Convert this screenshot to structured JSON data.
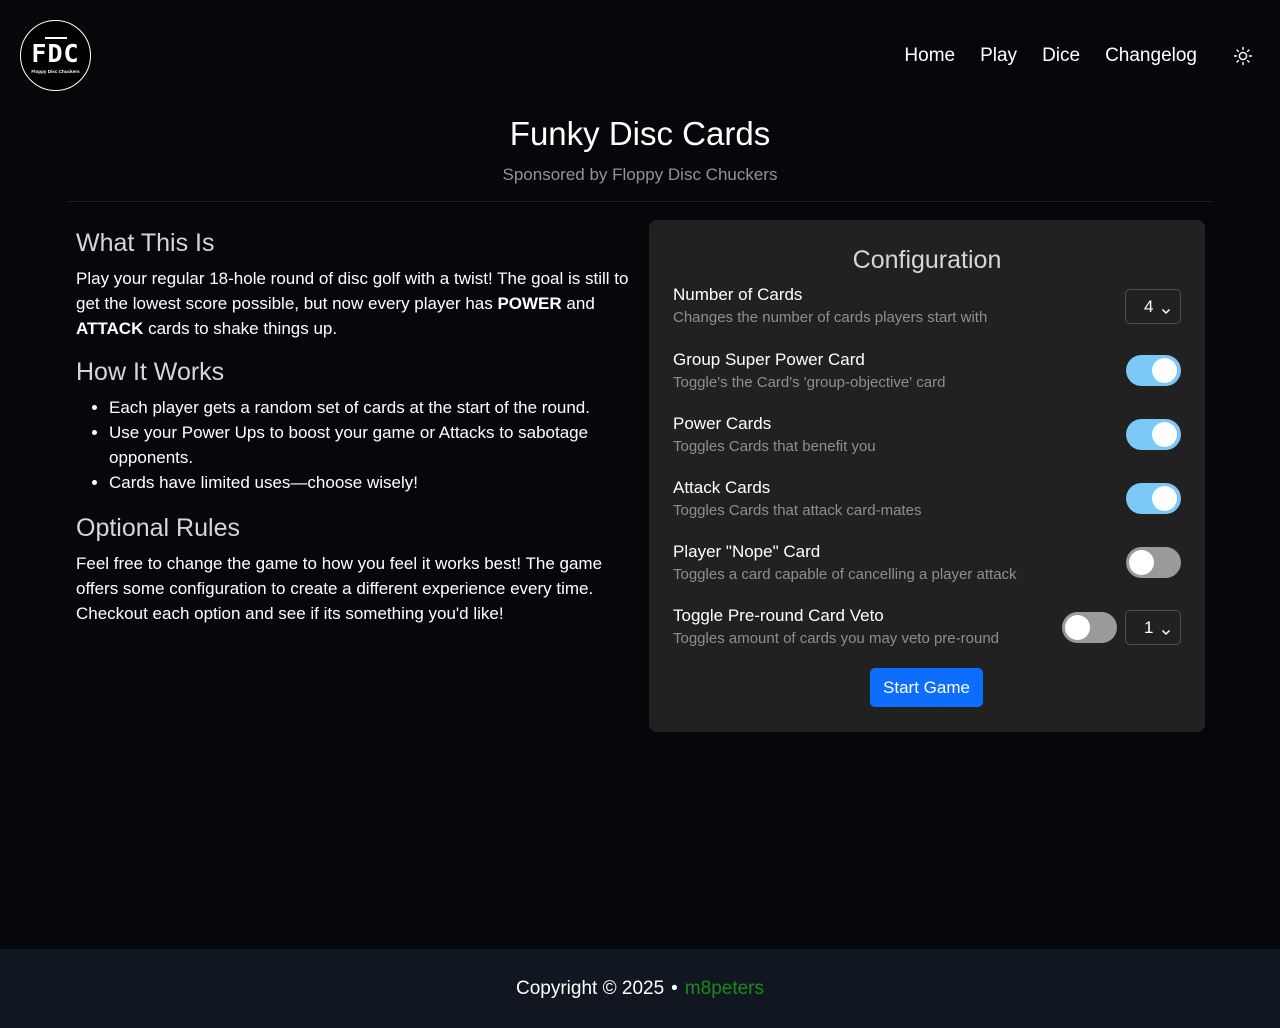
{
  "header": {
    "logo": {
      "text": "FDC",
      "subtext": "Floppy Disc Chuckers"
    },
    "nav": [
      {
        "label": "Home"
      },
      {
        "label": "Play"
      },
      {
        "label": "Dice"
      },
      {
        "label": "Changelog"
      }
    ],
    "theme_icon": "sun-icon"
  },
  "title": {
    "heading": "Funky Disc Cards",
    "subtitle": "Sponsored by Floppy Disc Chuckers"
  },
  "info": {
    "what_heading": "What This Is",
    "what_text_1": "Play your regular 18-hole round of disc golf with a twist! The goal is still to get the lowest score possible, but now every player has ",
    "what_bold_1": "POWER",
    "what_text_2": " and ",
    "what_bold_2": "ATTACK",
    "what_text_3": " cards to shake things up.",
    "how_heading": "How It Works",
    "how_items": [
      "Each player gets a random set of cards at the start of the round.",
      "Use your Power Ups to boost your game or Attacks to sabotage opponents.",
      "Cards have limited uses—choose wisely!"
    ],
    "rules_heading": "Optional Rules",
    "rules_text": "Feel free to change the game to how you feel it works best! The game offers some configuration to create a different experience every time. Checkout each option and see if its something you'd like!"
  },
  "config": {
    "title": "Configuration",
    "options": [
      {
        "label": "Number of Cards",
        "desc": "Changes the number of cards players start with",
        "select_value": "4"
      },
      {
        "label": "Group Super Power Card",
        "desc": "Toggle's the Card's 'group-objective' card",
        "toggle": "on"
      },
      {
        "label": "Power Cards",
        "desc": "Toggles Cards that benefit you",
        "toggle": "on"
      },
      {
        "label": "Attack Cards",
        "desc": "Toggles Cards that attack card-mates",
        "toggle": "on"
      },
      {
        "label": "Player \"Nope\" Card",
        "desc": "Toggles a card capable of cancelling a player attack",
        "toggle": "off"
      },
      {
        "label": "Toggle Pre-round Card Veto",
        "desc": "Toggles amount of cards you may veto pre-round",
        "toggle": "off",
        "select_value": "1"
      }
    ],
    "start_label": "Start Game",
    "colors": {
      "toggle_on": "#7cc8f8",
      "toggle_off": "#9a9a9a",
      "button": "#0d6efd"
    }
  },
  "footer": {
    "copyright": "Copyright © 2025",
    "separator": "•",
    "author": "m8peters",
    "author_color": "#1c8a1c"
  }
}
